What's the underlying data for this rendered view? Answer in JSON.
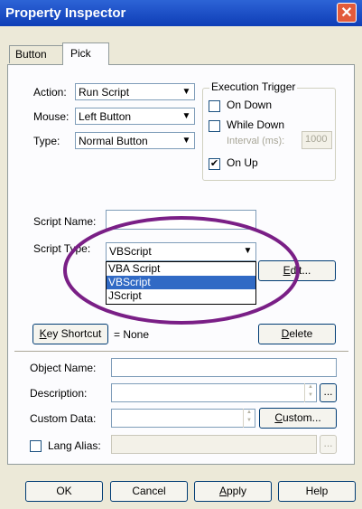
{
  "window": {
    "title": "Property Inspector",
    "close_glyph": "✕"
  },
  "tabs": [
    {
      "label": "Button"
    },
    {
      "label": "Pick"
    }
  ],
  "action": {
    "label": "Action:",
    "value": "Run Script"
  },
  "mouse": {
    "label": "Mouse:",
    "value": "Left Button"
  },
  "type": {
    "label": "Type:",
    "value": "Normal Button"
  },
  "execution_trigger": {
    "title": "Execution Trigger",
    "on_down": {
      "label": "On Down",
      "checked": false
    },
    "while_down": {
      "label": "While Down",
      "checked": false
    },
    "interval_label": "Interval (ms):",
    "interval_value": "1000",
    "on_up": {
      "label": "On Up",
      "checked": true,
      "mark": "✔"
    }
  },
  "script_name": {
    "label": "Script Name:",
    "value": ""
  },
  "script_type": {
    "label_pre": "Script T",
    "label_post": "pe:",
    "value": "VBScript",
    "options": [
      "VBA Script",
      "VBScript",
      "JScript"
    ],
    "selected": "VBScript"
  },
  "edit_button": {
    "pre": "",
    "mnemonic": "E",
    "post": "dit..."
  },
  "key_shortcut": {
    "mnemonic": "K",
    "rest": "ey Shortcut",
    "value": "= None"
  },
  "delete_button": {
    "mnemonic": "D",
    "rest": "elete"
  },
  "object_name": {
    "label": "Object Name:",
    "value": ""
  },
  "description": {
    "label": "Description:",
    "value": ""
  },
  "custom_data": {
    "label": "Custom Data:",
    "value": ""
  },
  "custom_button": {
    "mnemonic": "C",
    "rest": "ustom..."
  },
  "ellipsis": "...",
  "lang_alias": {
    "label": "Lang Alias:",
    "checked": false
  },
  "footer": {
    "ok": "OK",
    "cancel": "Cancel",
    "apply_mnemonic": "A",
    "apply_rest": "pply",
    "help": "Help"
  },
  "annotation": {
    "color": "#7a1f86"
  },
  "colors": {
    "title_bar": "#1f52c8",
    "selection": "#316ac5",
    "dialog": "#ece9d8",
    "panel": "#fcfcfe"
  }
}
